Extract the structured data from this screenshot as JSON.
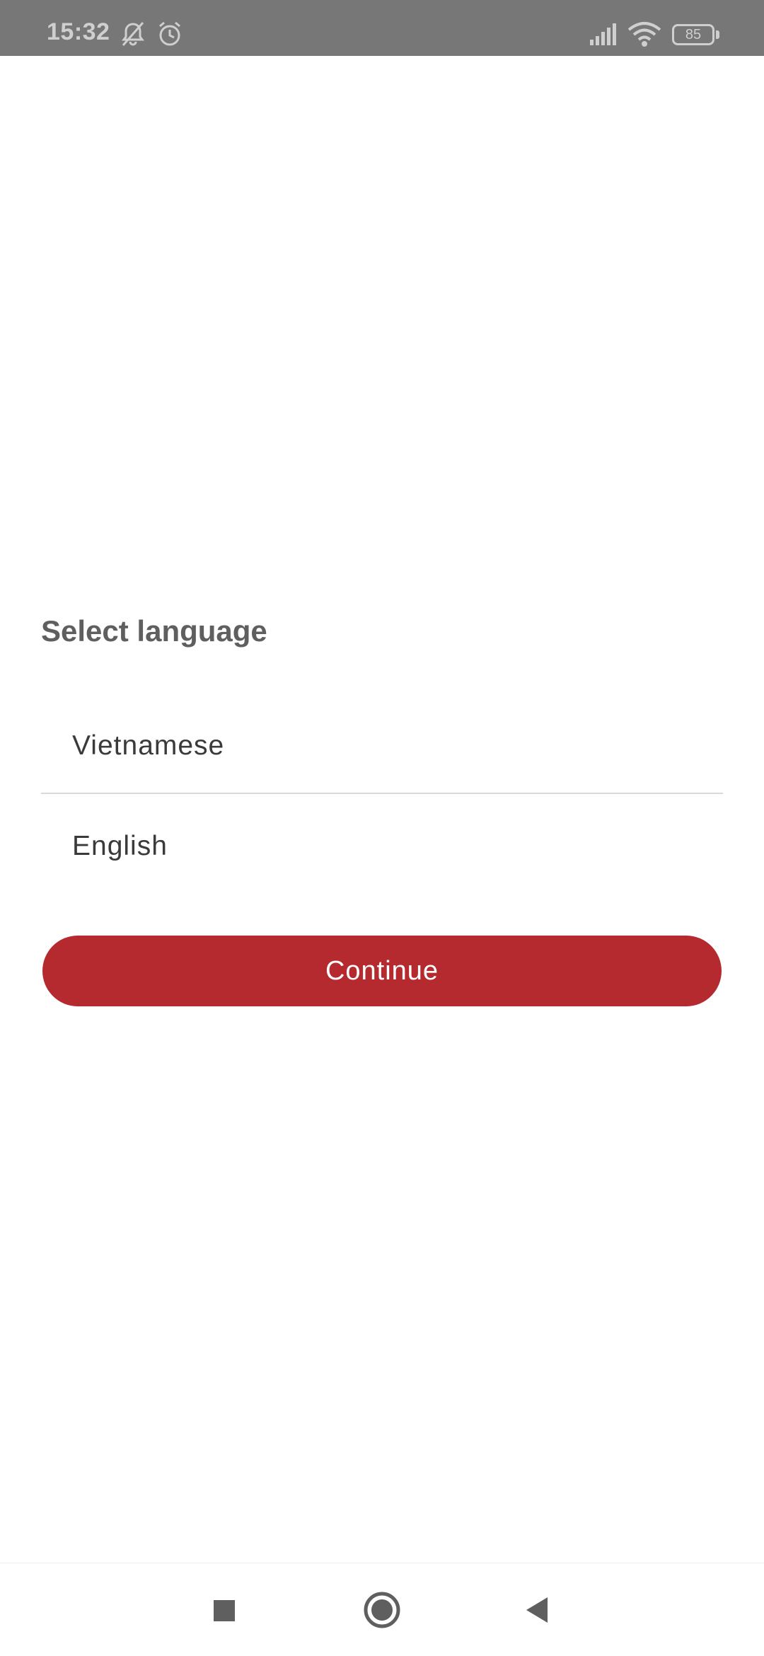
{
  "status_bar": {
    "time": "15:32",
    "battery": "85",
    "icons": [
      "notifications-off-icon",
      "alarm-icon",
      "signal-icon",
      "wifi-icon",
      "battery-icon"
    ]
  },
  "main": {
    "title": "Select language",
    "options": [
      {
        "label": "Vietnamese"
      },
      {
        "label": "English"
      }
    ],
    "continue_label": "Continue"
  },
  "nav_bar": {
    "icons": [
      "recents-square-icon",
      "home-circle-icon",
      "back-triangle-icon"
    ]
  },
  "colors": {
    "accent": "#b52a2e",
    "status_bar_bg": "#777777",
    "title_text": "#5f5f5f",
    "option_text": "#3a3a3a"
  }
}
